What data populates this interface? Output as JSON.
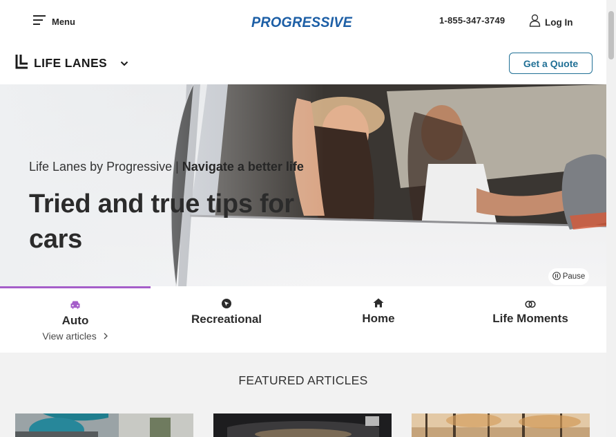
{
  "header": {
    "menu_label": "Menu",
    "logo_text": "PROGRESSIVE",
    "phone": "1-855-347-3749",
    "login_label": "Log In"
  },
  "subheader": {
    "brand_label": "LIFE LANES",
    "quote_label": "Get a Quote"
  },
  "hero": {
    "eyebrow_prefix": "Life Lanes by Progressive | ",
    "eyebrow_strong": "Navigate a better life",
    "title": "Tried and true tips for cars",
    "pause_label": "Pause"
  },
  "tabs": [
    {
      "label": "Auto",
      "icon": "car-icon",
      "active": true,
      "link": "View articles"
    },
    {
      "label": "Recreational",
      "icon": "compass-icon"
    },
    {
      "label": "Home",
      "icon": "home-icon"
    },
    {
      "label": "Life Moments",
      "icon": "rings-icon"
    }
  ],
  "featured": {
    "title": "FEATURED ARTICLES"
  },
  "colors": {
    "brand_blue": "#1f6f95",
    "logo_blue": "#1d5fa6",
    "active_tab_purple": "#a55ec9"
  }
}
